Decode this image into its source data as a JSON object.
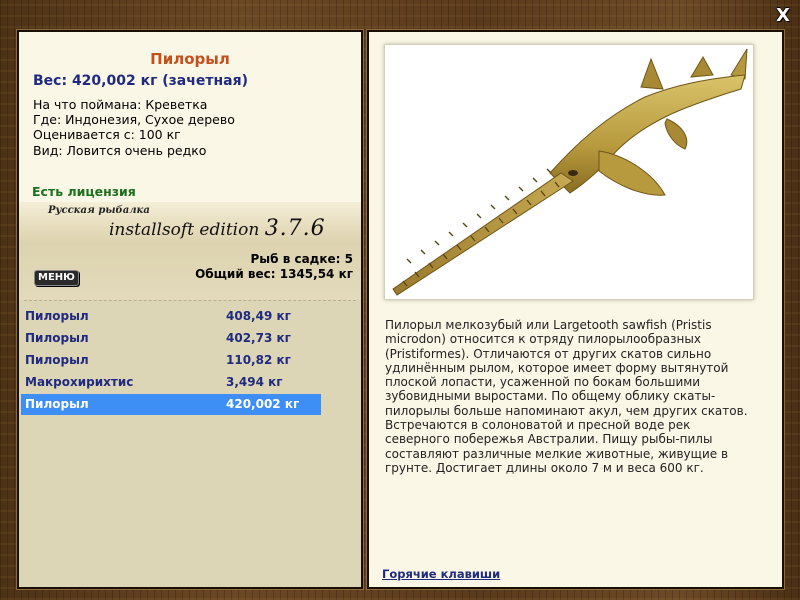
{
  "window": {
    "close_label": "X"
  },
  "fish": {
    "title": "Пилорыл",
    "weight_line": "Вес: 420,002 кг (зачетная)",
    "caught_on": "На что поймана: Креветка",
    "location": "Где: Индонезия, Сухое дерево",
    "valued_from": "Оценивается с: 100 кг",
    "rarity": "Вид: Ловится очень редко"
  },
  "license": "Есть лицензия",
  "edition": {
    "small": "Русская рыбалка",
    "main": "installsoft edition",
    "version": "3.7.6"
  },
  "stats": {
    "in_keepnet": "Рыб в садке: 5",
    "total_weight": "Общий вес: 1345,54 кг"
  },
  "menu_label": "МЕНЮ",
  "catch_list": [
    {
      "name": "Пилорыл",
      "weight": "408,49 кг"
    },
    {
      "name": "Пилорыл",
      "weight": "402,73 кг"
    },
    {
      "name": "Пилорыл",
      "weight": "110,82 кг"
    },
    {
      "name": "Макрохирихтис",
      "weight": "3,494 кг"
    },
    {
      "name": "Пилорыл",
      "weight": "420,002 кг",
      "selected": true
    }
  ],
  "description": "Пилорыл мелкозубый или Largetooth sawfish (Pristis microdon) относится к отряду пилорылообразных (Pristiformes). Отличаются от других скатов сильно удлинённым рылом, которое имеет форму вытянутой плоской лопасти, усаженной по бокам большими зубовидными выростами. По общему облику скаты-пилорылы больше напоминают акул, чем других скатов. Встречаются в солоноватой и пресной воде рек северного побережья Австралии. Пищу рыбы-пилы составляют различные мелкие животные, живущие в грунте. Достигает длины около 7 м и веса 600 кг.",
  "hotkeys_label": "Горячие клавиши",
  "colors": {
    "title": "#c4501c",
    "accent_blue": "#1f2a80",
    "license_green": "#1d6e1d",
    "selected_row": "#3d8ff5",
    "panel_bg": "#fbf7e7"
  }
}
